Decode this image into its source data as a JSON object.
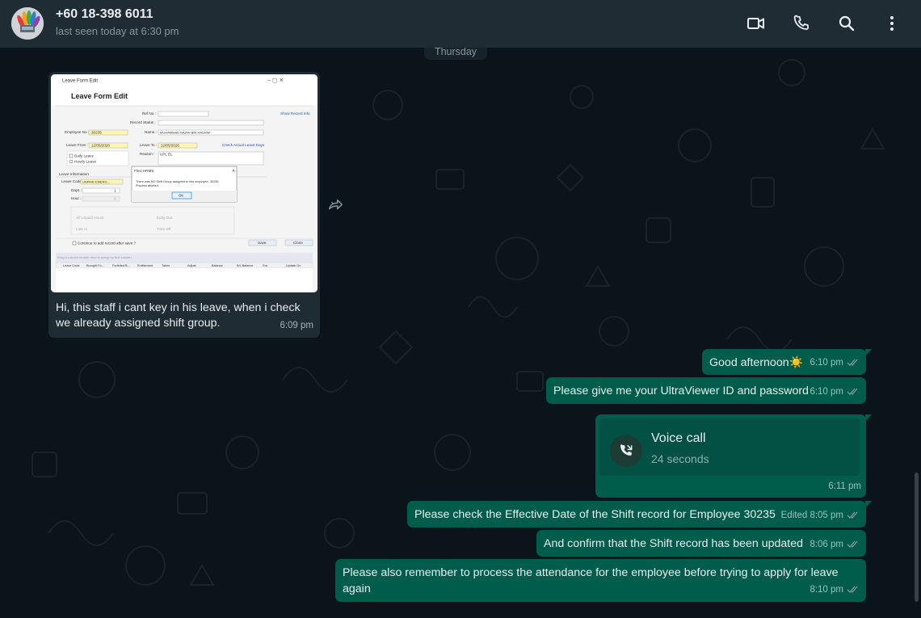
{
  "header": {
    "contact_name": "+60 18-398 6011",
    "status": "last seen today at 6:30 pm",
    "icons": [
      "video-call-icon",
      "phone-icon",
      "search-icon",
      "menu-icon"
    ]
  },
  "date_chip": "Thursday",
  "colors": {
    "background": "#0b141a",
    "header": "#202c33",
    "incoming_bubble": "#202c33",
    "outgoing_bubble": "#005c4b",
    "read_tick": "#8696a0"
  },
  "incoming": {
    "caption_line1": "Hi, this staff i cant key in his leave, when i check",
    "caption_line2": "we already assigned shift group.",
    "time": "6:09 pm",
    "screenshot": {
      "window_title": "Leave Form Edit",
      "heading": "Leave Form Edit",
      "ref_no_label": "Ref No :",
      "record_status_label": "Record Status :",
      "show_record_info": "Show Record Info",
      "employee_no_label": "Employee No :",
      "employee_no": "30235",
      "name_label": "Name :",
      "name_value": "MUHAMMAD NAZMI BIN HASHIM",
      "leave_from_label": "Leave From :",
      "leave_from": "12/05/2026",
      "leave_to_label": "Leave To :",
      "leave_to": "12/05/2026",
      "check_leave_days": "Check Actual Leave Days",
      "daily_leave": "Daily Leave",
      "hourly_leave": "Hourly Leave",
      "reason_label": "Reason :",
      "reason_value": "UPL EL",
      "leave_info": "Leave Information",
      "leave_code_label": "Leave Code :",
      "leave_code": "UNPAID EMERG...",
      "days_label": "Days :",
      "days_value": "1",
      "hour_label": "Hour :",
      "hour_value": "0",
      "dialog_title": "Flexi HRMS",
      "dialog_line1": "There was NO Shift Group assigned to this employee, 30235.",
      "dialog_line2": "Process aborted.",
      "dialog_ok": "OK",
      "option1": "All Unpaid Hours",
      "option2": "Early Out",
      "option3": "Late In",
      "option4": "Time Off",
      "continue_label": "Continue to add record after save ?",
      "save": "Save",
      "close": "Close",
      "group_hint": "Drag a column header here to group by that column",
      "columns": [
        "Leave Code",
        "Brought Fo...",
        "Forfeited B...",
        "Entitlement",
        "Taken",
        "Adjust",
        "Balance",
        "B/L Balance",
        "Fox",
        "Update On"
      ]
    }
  },
  "outgoing": [
    {
      "text": "Good afternoon☀️",
      "time": "6:10 pm"
    },
    {
      "text": "Please give me your UltraViewer ID and password",
      "time": "6:10 pm"
    },
    {
      "title": "Voice call",
      "duration": "24 seconds",
      "time": "6:11 pm"
    },
    {
      "text": "Please check the Effective Date of the Shift record for Employee 30235",
      "edited": "Edited",
      "time": "8:05 pm"
    },
    {
      "text": "And confirm that the Shift record has been updated",
      "time": "8:06 pm"
    },
    {
      "text_line1": "Please also remember to process the attendance for the employee before trying to apply for leave",
      "text_line2": "again",
      "time": "8:10 pm"
    }
  ]
}
